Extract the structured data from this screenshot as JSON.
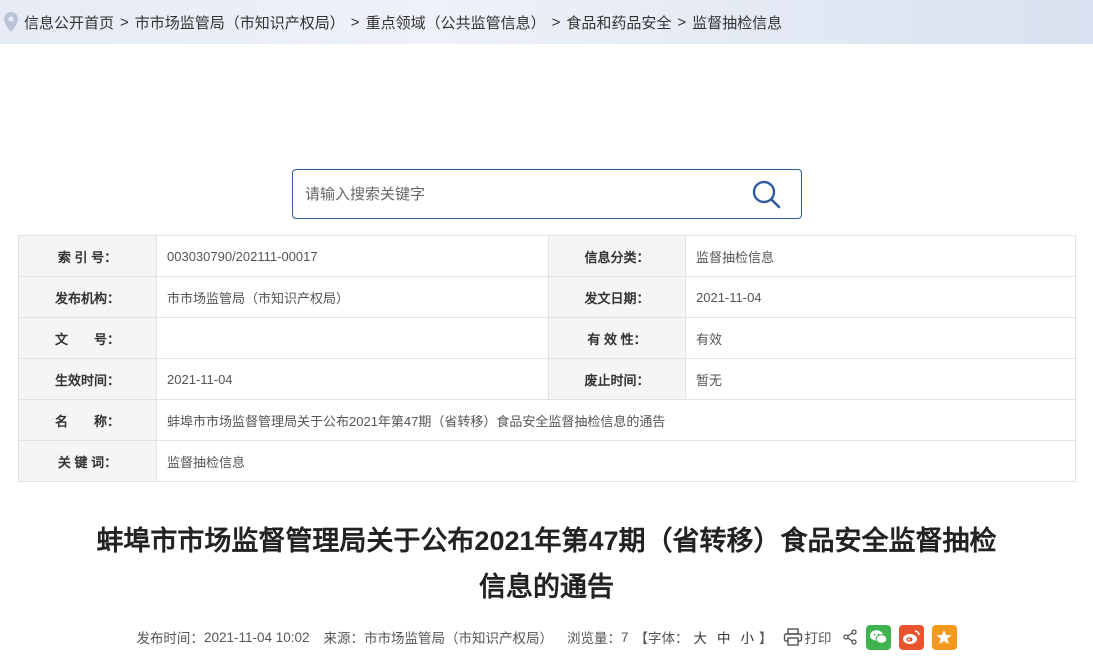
{
  "breadcrumb": {
    "items": [
      "信息公开首页",
      "市市场监管局（市知识产权局）",
      "重点领域（公共监管信息）",
      "食品和药品安全",
      "监督抽检信息"
    ],
    "separator": ">"
  },
  "search": {
    "placeholder": "请输入搜索关键字",
    "value": ""
  },
  "meta": {
    "index_label": "索 引 号：",
    "index_value": "003030790/202111-00017",
    "category_label": "信息分类：",
    "category_value": "监督抽检信息",
    "issuer_label": "发布机构：",
    "issuer_value": "市市场监管局（市知识产权局）",
    "issue_date_label": "发文日期：",
    "issue_date_value": "2021-11-04",
    "doc_no_label": "文　　号：",
    "doc_no_value": "",
    "validity_label": "有 效 性：",
    "validity_value": "有效",
    "effective_label": "生效时间：",
    "effective_value": "2021-11-04",
    "repeal_label": "废止时间：",
    "repeal_value": "暂无",
    "name_label": "名　　称：",
    "name_value": "蚌埠市市场监督管理局关于公布2021年第47期（省转移）食品安全监督抽检信息的通告",
    "keywords_label": "关 键 词：",
    "keywords_value": "监督抽检信息"
  },
  "article": {
    "title_line1": "蚌埠市市场监督管理局关于公布2021年第47期（省转移）食品安全监督抽检",
    "title_line2": "信息的通告"
  },
  "info": {
    "publish_label": "发布时间：",
    "publish_value": "2021-11-04 10:02",
    "source_label": "来源：",
    "source_value": "市市场监管局（市知识产权局）",
    "views_label": "浏览量：",
    "views_value": "7",
    "font_label_open": "【字体：",
    "font_large": "大",
    "font_medium": "中",
    "font_small": "小",
    "font_label_close": "】",
    "print_label": "打印"
  },
  "colors": {
    "accent": "#2f5a9e",
    "wechat": "#3fb34f",
    "weibo": "#e8542d",
    "favorite": "#f39a1e"
  },
  "icons": [
    "location-pin-icon",
    "search-icon",
    "print-icon",
    "share-icon",
    "wechat-icon",
    "weibo-icon",
    "star-icon"
  ]
}
